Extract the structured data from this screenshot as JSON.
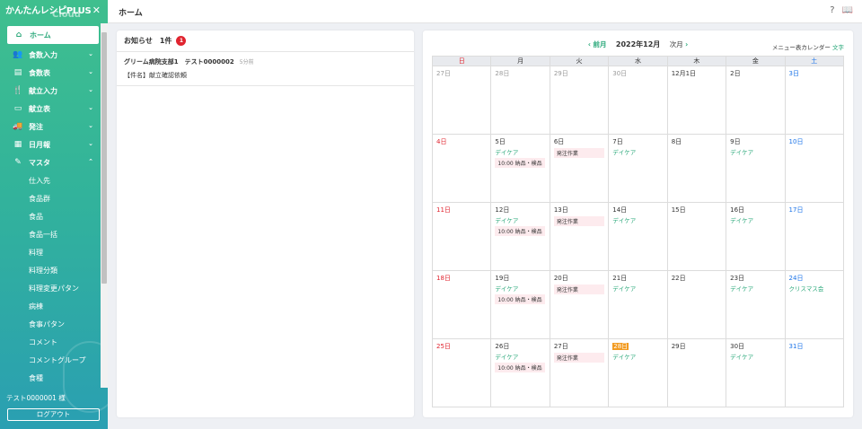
{
  "sidebar": {
    "logo": "かんたんレシピPLUS",
    "logo_sub": "Cloud",
    "close": "✕",
    "items": [
      {
        "label": "ホーム",
        "icon": "⌂",
        "chev": ""
      },
      {
        "label": "食数入力",
        "icon": "👥",
        "chev": "⌄"
      },
      {
        "label": "食数表",
        "icon": "▤",
        "chev": "⌄"
      },
      {
        "label": "献立入力",
        "icon": "🍴",
        "chev": "⌄"
      },
      {
        "label": "献立表",
        "icon": "▭",
        "chev": "⌄"
      },
      {
        "label": "発注",
        "icon": "🚚",
        "chev": "⌄"
      },
      {
        "label": "日月報",
        "icon": "▦",
        "chev": "⌄"
      },
      {
        "label": "マスタ",
        "icon": "✎",
        "chev": "⌃"
      }
    ],
    "subitems": [
      "仕入先",
      "食品群",
      "食品",
      "食品一括",
      "料理",
      "料理分類",
      "料理変更パタン",
      "病棟",
      "食事パタン",
      "コメント",
      "コメントグループ",
      "食種"
    ],
    "user": "テスト0000001 様",
    "logout": "ログアウト"
  },
  "header": {
    "title": "ホーム",
    "help_icon": "?",
    "book_icon": "📖"
  },
  "news": {
    "title": "お知らせ　1件",
    "count": "1",
    "items": [
      {
        "from": "グリーム病院支部1　テスト0000002",
        "ago": "5分前",
        "subject": "【件名】献立確認依頼"
      }
    ]
  },
  "calendar": {
    "prev": "前月",
    "month": "2022年12月",
    "next": "次月",
    "option_label": "メニュー表カレンダー",
    "option_link": "文字",
    "weekdays": [
      "日",
      "月",
      "火",
      "水",
      "木",
      "金",
      "土"
    ],
    "weeks": [
      [
        {
          "d": "27日",
          "g": 1
        },
        {
          "d": "28日",
          "g": 1
        },
        {
          "d": "29日",
          "g": 1
        },
        {
          "d": "30日",
          "g": 1
        },
        {
          "d": "12月1日"
        },
        {
          "d": "2日"
        },
        {
          "d": "3日"
        }
      ],
      [
        {
          "d": "4日"
        },
        {
          "d": "5日",
          "ev": "デイケア",
          "tag": "10:00 納品・検品"
        },
        {
          "d": "6日",
          "tag": "発注作業"
        },
        {
          "d": "7日",
          "ev": "デイケア"
        },
        {
          "d": "8日"
        },
        {
          "d": "9日",
          "ev": "デイケア"
        },
        {
          "d": "10日"
        }
      ],
      [
        {
          "d": "11日"
        },
        {
          "d": "12日",
          "ev": "デイケア",
          "tag": "10:00 納品・検品"
        },
        {
          "d": "13日",
          "tag": "発注作業"
        },
        {
          "d": "14日",
          "ev": "デイケア"
        },
        {
          "d": "15日"
        },
        {
          "d": "16日",
          "ev": "デイケア"
        },
        {
          "d": "17日"
        }
      ],
      [
        {
          "d": "18日"
        },
        {
          "d": "19日",
          "ev": "デイケア",
          "tag": "10:00 納品・検品"
        },
        {
          "d": "20日",
          "tag": "発注作業"
        },
        {
          "d": "21日",
          "ev": "デイケア"
        },
        {
          "d": "22日"
        },
        {
          "d": "23日",
          "ev": "デイケア"
        },
        {
          "d": "24日",
          "ev": "クリスマス会"
        }
      ],
      [
        {
          "d": "25日"
        },
        {
          "d": "26日",
          "ev": "デイケア",
          "tag": "10:00 納品・検品"
        },
        {
          "d": "27日",
          "tag": "発注作業"
        },
        {
          "d": "28日",
          "ev": "デイケア",
          "today": 1
        },
        {
          "d": "29日"
        },
        {
          "d": "30日",
          "ev": "デイケア"
        },
        {
          "d": "31日"
        }
      ]
    ]
  },
  "colors": {
    "accent": "#2aa87a",
    "sunday": "#e0242f",
    "saturday": "#1a73e8",
    "today": "#f29a1f"
  }
}
